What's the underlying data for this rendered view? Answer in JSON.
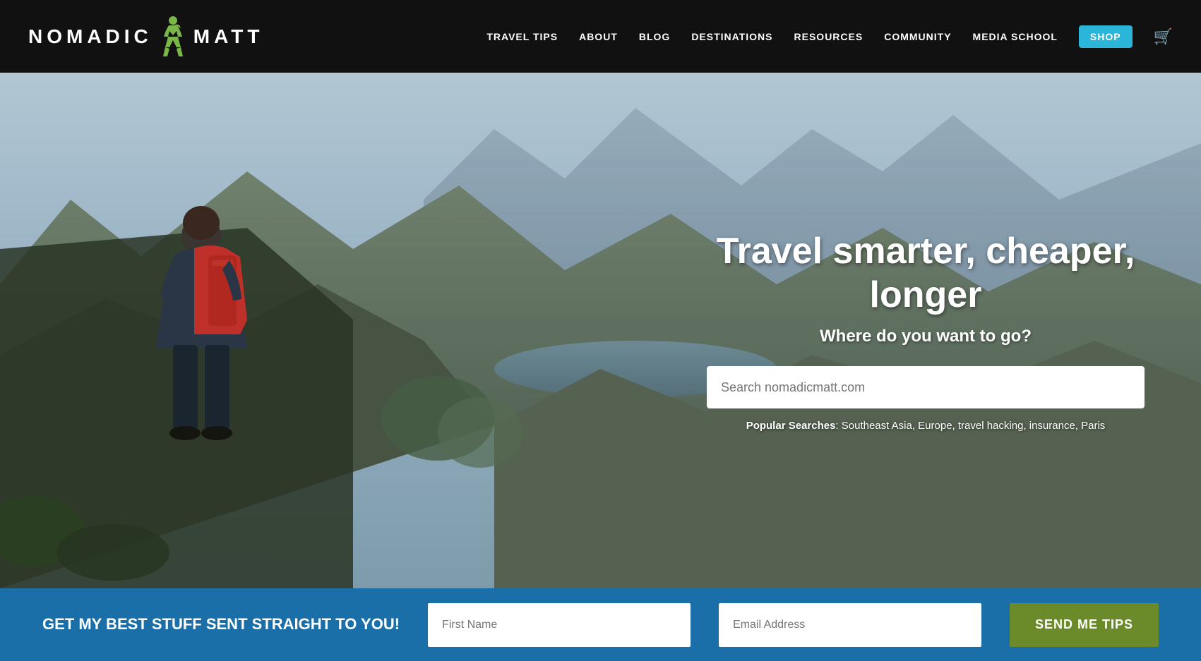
{
  "header": {
    "logo_nomadic": "NoMADIC",
    "logo_matt": "MATT",
    "nav": {
      "items": [
        {
          "label": "TRAVEL TIPS",
          "name": "travel-tips"
        },
        {
          "label": "ABOUT",
          "name": "about"
        },
        {
          "label": "BLOG",
          "name": "blog"
        },
        {
          "label": "DESTINATIONS",
          "name": "destinations"
        },
        {
          "label": "RESOURCES",
          "name": "resources"
        },
        {
          "label": "COMMUNITY",
          "name": "community"
        },
        {
          "label": "MEDIA SCHOOL",
          "name": "media-school"
        }
      ],
      "shop_label": "SHOP"
    }
  },
  "hero": {
    "title": "Travel smarter, cheaper, longer",
    "subtitle": "Where do you want to go?",
    "search_placeholder": "Search nomadicmatt.com",
    "popular_label": "Popular Searches",
    "popular_items": ": Southeast Asia, Europe, travel hacking, insurance, Paris"
  },
  "bottom_bar": {
    "cta_text": "GET MY BEST STUFF SENT STRAIGHT TO YOU!",
    "first_name_placeholder": "First Name",
    "email_placeholder": "Email Address",
    "button_label": "SEND ME TIPS"
  }
}
